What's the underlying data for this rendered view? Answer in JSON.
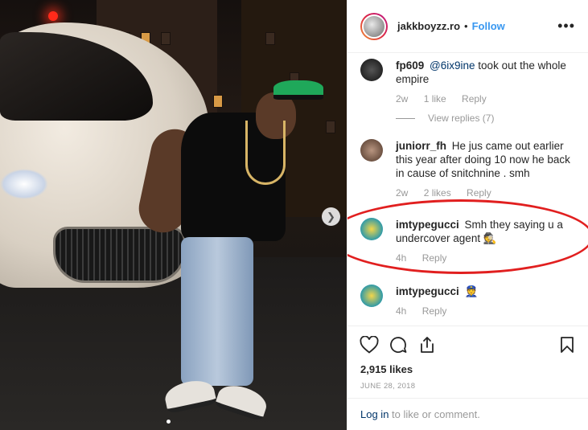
{
  "header": {
    "username": "jakkboyzz.ro",
    "separator": "•",
    "follow_label": "Follow",
    "more_label": "•••"
  },
  "comments": [
    {
      "user": "fp609",
      "mention": "@6ix9ine",
      "text": " took out the whole empire",
      "time": "2w",
      "likes": "1 like",
      "reply": "Reply",
      "view_replies": "View replies (7)",
      "avatar_color": "#1d1d1d"
    },
    {
      "user": "juniorr_fh",
      "text": "He jus came out earlier this year after doing 10 now he back in cause of snitchnine . smh",
      "time": "2w",
      "likes": "2 likes",
      "reply": "Reply",
      "avatar_color": "#8a6b57"
    },
    {
      "user": "imtypegucci",
      "text": "Smh they saying u a undercover agent 🕵",
      "time": "4h",
      "reply": "Reply",
      "avatar_color": "#3aa6b0"
    },
    {
      "user": "imtypegucci",
      "text": "👮",
      "time": "4h",
      "reply": "Reply",
      "avatar_color": "#3aa6b0"
    }
  ],
  "actions": {
    "likes": "2,915 likes",
    "date": "JUNE 28, 2018"
  },
  "login": {
    "link": "Log in",
    "rest": " to like or comment."
  },
  "icons": [
    "heart-icon",
    "comment-icon",
    "share-icon",
    "bookmark-icon",
    "chevron-right-icon"
  ],
  "colors": {
    "follow": "#3897f0",
    "annotation": "#e11f1f"
  }
}
